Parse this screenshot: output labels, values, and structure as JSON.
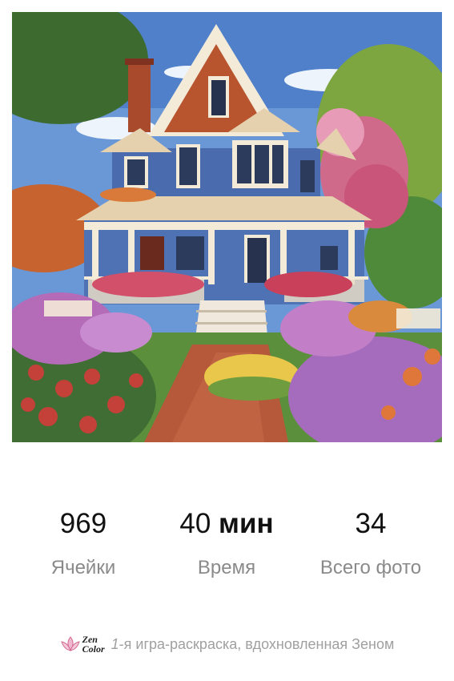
{
  "stats": {
    "cells": {
      "value": "969",
      "label": "Ячейки"
    },
    "time": {
      "number": "40",
      "unit": "мин",
      "label": "Время"
    },
    "photos": {
      "value": "34",
      "label": "Всего фото"
    }
  },
  "footer": {
    "logo_line1": "Zen",
    "logo_line2": "Color",
    "tagline_num": "1",
    "tagline_rest": "-я игра-раскраска, вдохновленная Зеном"
  },
  "colors": {
    "sky": "#5f8fd0",
    "house_blue": "#4a6cae",
    "roof": "#e8d3b0",
    "brick": "#b65a34",
    "text_dark": "#111111",
    "text_muted": "#8a8a8a"
  }
}
